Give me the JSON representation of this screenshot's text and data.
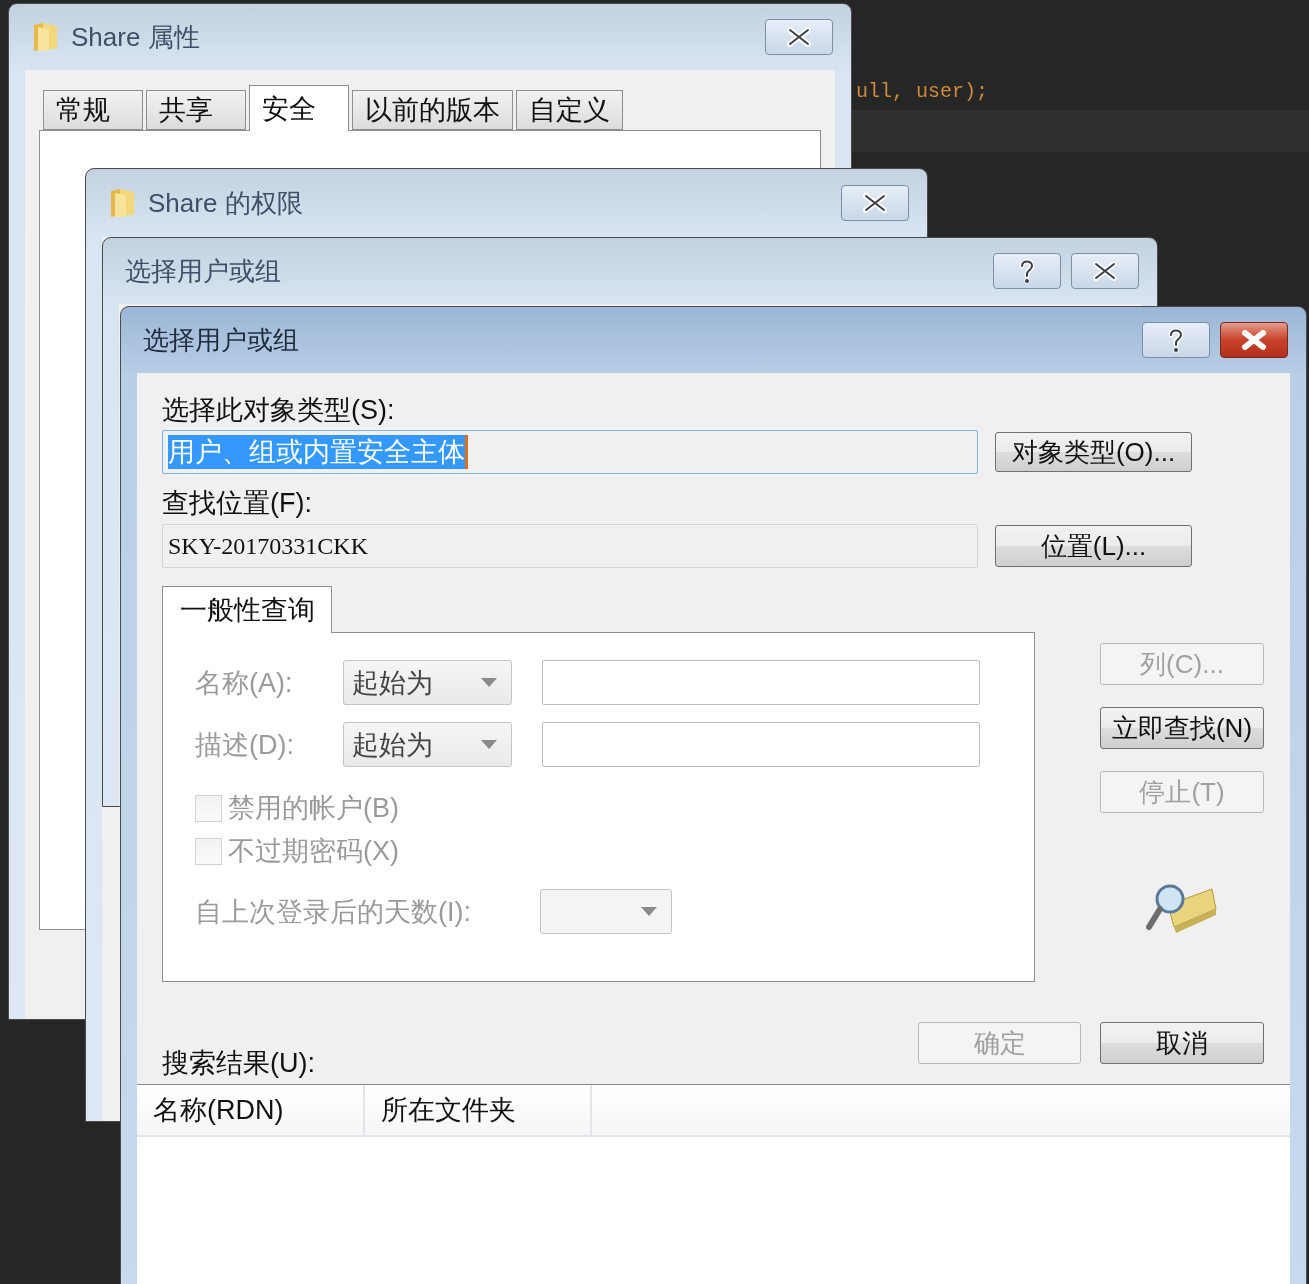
{
  "code_line": "ull, user);",
  "properties_window": {
    "title": "Share 属性",
    "active": false,
    "tabs": [
      {
        "label": "常规",
        "selected": false
      },
      {
        "label": "共享",
        "selected": false
      },
      {
        "label": "安全",
        "selected": true
      },
      {
        "label": "以前的版本",
        "selected": false
      },
      {
        "label": "自定义",
        "selected": false
      }
    ]
  },
  "permissions_window": {
    "title": "Share 的权限",
    "active": false
  },
  "select_window_back": {
    "title": "选择用户或组",
    "active": false
  },
  "select_dialog": {
    "title": "选择用户或组",
    "active": true,
    "object_types_label": "选择此对象类型(S):",
    "object_types_value": "用户、组或内置安全主体",
    "object_types_button": "对象类型(O)...",
    "location_label": "查找位置(F):",
    "location_value": "SKY-20170331CKK",
    "location_button": "位置(L)...",
    "query_tab": {
      "label": "一般性查询",
      "selected": true
    },
    "query_rows": [
      {
        "label": "名称(A):",
        "mode": "起始为"
      },
      {
        "label": "描述(D):",
        "mode": "起始为"
      }
    ],
    "checkboxes": [
      {
        "label": "禁用的帐户(B)",
        "checked": false,
        "disabled": true
      },
      {
        "label": "不过期密码(X)",
        "checked": false,
        "disabled": true
      }
    ],
    "days_label": "自上次登录后的天数(I):",
    "side_buttons": [
      {
        "label": "列(C)...",
        "disabled": true
      },
      {
        "label": "立即查找(N)",
        "disabled": false
      },
      {
        "label": "停止(T)",
        "disabled": true
      }
    ],
    "ok_button": {
      "label": "确定",
      "disabled": true
    },
    "cancel_button": {
      "label": "取消",
      "disabled": false
    },
    "results_label": "搜索结果(U):",
    "results_columns": [
      "名称(RDN)",
      "所在文件夹"
    ]
  }
}
